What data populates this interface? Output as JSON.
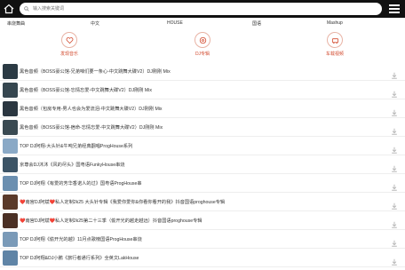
{
  "search": {
    "placeholder": "输入搜索关键词"
  },
  "categories": [
    {
      "label": "串烧舞曲"
    },
    {
      "label": "中文"
    },
    {
      "label": "HOUSE"
    },
    {
      "label": "国语"
    },
    {
      "label": "Mashup"
    }
  ],
  "features": [
    {
      "label": "发现音乐",
      "icon": "heart-icon",
      "color": "#d24a2e"
    },
    {
      "label": "DJ专辑",
      "icon": "disc-icon",
      "color": "#d24a2e"
    },
    {
      "label": "车载视频",
      "icon": "car-video-icon",
      "color": "#d24a2e"
    }
  ],
  "tracks": [
    {
      "title": "黑色音频（BOSS豪公馆-兄弟咱们要一条心-中文跳舞大碟V2）DJ刚刚 Mix",
      "thumb": "#2b3a44"
    },
    {
      "title": "黑色音频（BOSS豪公馆-忘情忘爱-中文跳舞大碟V2）DJ刚刚 Mix",
      "thumb": "#35464f"
    },
    {
      "title": "黑色音频（包房专用-男人也会为爱流泪-中文跳舞大碟V2）DJ刚刚 Mix",
      "thumb": "#2a3640"
    },
    {
      "title": "黑色音频（BOSS豪公馆-宿命-忘情忘爱-中文跳舞大碟V2）DJ刚刚 Mix",
      "thumb": "#3a4a52"
    },
    {
      "title": "TOP DJ阿翔-大头针&牛吨兄弟经典翻唱ProgHouse系列",
      "thumb": "#8aa9c6"
    },
    {
      "title": "京尊会DJ沐沐《风的尽头》国粤语FunkyHouse串烧",
      "thumb": "#3c5466"
    },
    {
      "title": "TOP DJ阿翔《有爱的芳华香诺人的过》国粤语ProgHouse串",
      "thumb": "#6b8fb0"
    },
    {
      "title": "❤️南宫DJ阿斌❤️私人定制2k25 大头针专辑《我爱你爱你&你看你看开的我》抖音国语proghouse专辑",
      "thumb": "#5a3a2a"
    },
    {
      "title": "❤️南宫DJ阿斌❤️私人定制2k25第二十三季（偷开光的越走越远）抖音国语proghouse专辑",
      "thumb": "#4a2f24"
    },
    {
      "title": "TOP DJ阿翔《偷开光的越》11月点歌榜国语ProgHouse串烧",
      "thumb": "#7a9ab8"
    },
    {
      "title": "TOP DJ阿翔&DJ小鹏《旅行者通行系列》全英文LakHouse",
      "thumb": "#5f84a6"
    }
  ]
}
